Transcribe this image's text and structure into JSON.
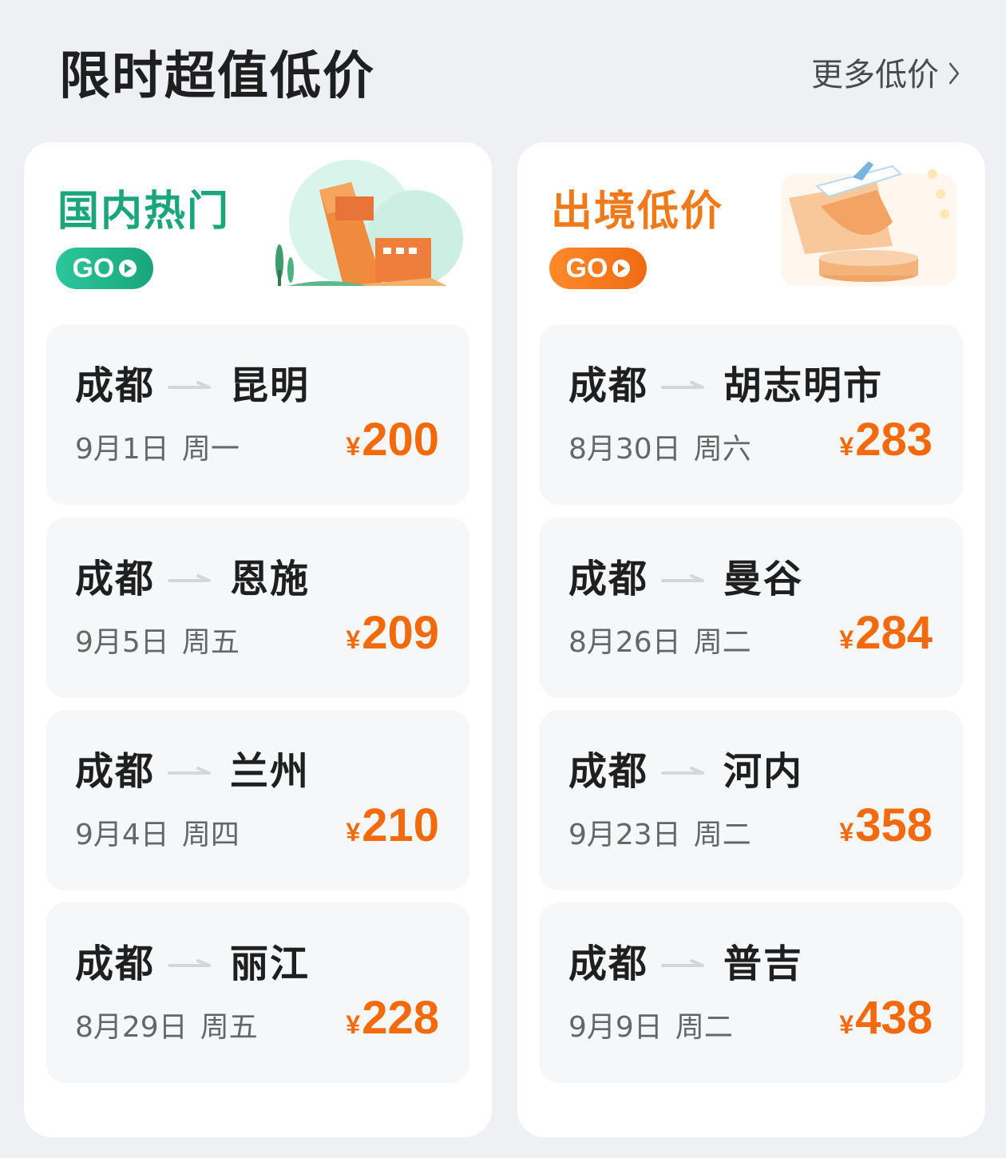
{
  "header": {
    "title": "限时超值低价",
    "more_label": "更多低价"
  },
  "domestic": {
    "title": "国内热门",
    "go_label": "GO",
    "accent": "#1aa57b",
    "routes": [
      {
        "from": "成都",
        "to": "昆明",
        "date": "9月1日",
        "weekday": "周一",
        "currency": "¥",
        "price": "200"
      },
      {
        "from": "成都",
        "to": "恩施",
        "date": "9月5日",
        "weekday": "周五",
        "currency": "¥",
        "price": "209"
      },
      {
        "from": "成都",
        "to": "兰州",
        "date": "9月4日",
        "weekday": "周四",
        "currency": "¥",
        "price": "210"
      },
      {
        "from": "成都",
        "to": "丽江",
        "date": "8月29日",
        "weekday": "周五",
        "currency": "¥",
        "price": "228"
      }
    ]
  },
  "international": {
    "title": "出境低价",
    "go_label": "GO",
    "accent": "#f07a1a",
    "routes": [
      {
        "from": "成都",
        "to": "胡志明市",
        "date": "8月30日",
        "weekday": "周六",
        "currency": "¥",
        "price": "283"
      },
      {
        "from": "成都",
        "to": "曼谷",
        "date": "8月26日",
        "weekday": "周二",
        "currency": "¥",
        "price": "284"
      },
      {
        "from": "成都",
        "to": "河内",
        "date": "9月23日",
        "weekday": "周二",
        "currency": "¥",
        "price": "358"
      },
      {
        "from": "成都",
        "to": "普吉",
        "date": "9月9日",
        "weekday": "周二",
        "currency": "¥",
        "price": "438"
      }
    ]
  },
  "price_color": "#f26a0c",
  "icons": {
    "more": "chevron-right-icon",
    "go": "play-icon",
    "route_arrow": "arrow-right-icon",
    "domestic_illustration": "great-wall-illustration",
    "international_illustration": "airplane-illustration"
  }
}
